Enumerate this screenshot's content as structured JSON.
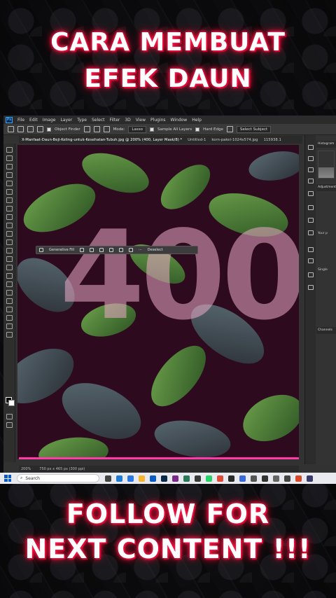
{
  "headline": {
    "line1": "CARA MEMBUAT",
    "line2": "EFEK DAUN",
    "footer1": "FOLLOW FOR",
    "footer2": "NEXT CONTENT !!!"
  },
  "photoshop": {
    "app_icon": "Ps",
    "menu": [
      "File",
      "Edit",
      "Image",
      "Layer",
      "Type",
      "Select",
      "Filter",
      "3D",
      "View",
      "Plugins",
      "Window",
      "Help"
    ],
    "options": {
      "object_finder": "Object Finder",
      "mode_label": "Mode:",
      "mode_value": "Lasso",
      "sample_all_layers": "Sample All Layers",
      "hard_edge": "Hard Edge",
      "select_subject": "Select Subject"
    },
    "tabs": [
      "X-Manfaat-Daun-Beji-Keling-untuk-Kesehatan-Tubuh.jpg @ 200% (400, Layer Mask/8) *",
      "Untitled-1",
      "korn-pakel-1024x574.jpg",
      "115938.1"
    ],
    "canvas_text": "400",
    "context_bar": {
      "generative_fill": "Generative Fill",
      "deselect": "Deselect"
    },
    "status": {
      "zoom": "200%",
      "doc_size": "750 px x 465 px (300 ppi)"
    },
    "panels": {
      "histogram": "Histogram",
      "adjustments": "Adjustments",
      "your_presets": "Your p",
      "single": "Single",
      "channels": "Channels"
    }
  },
  "taskbar": {
    "search_placeholder": "Search"
  },
  "colors": {
    "headline_glow": "#ff1a4a",
    "canvas_bg": "#2d0a1e",
    "leaf_green": "#4f8a3a",
    "number_pink": "#ecaac8",
    "selection_line": "#ff3aa8",
    "taskbar_bg": "#e8eaf0"
  }
}
